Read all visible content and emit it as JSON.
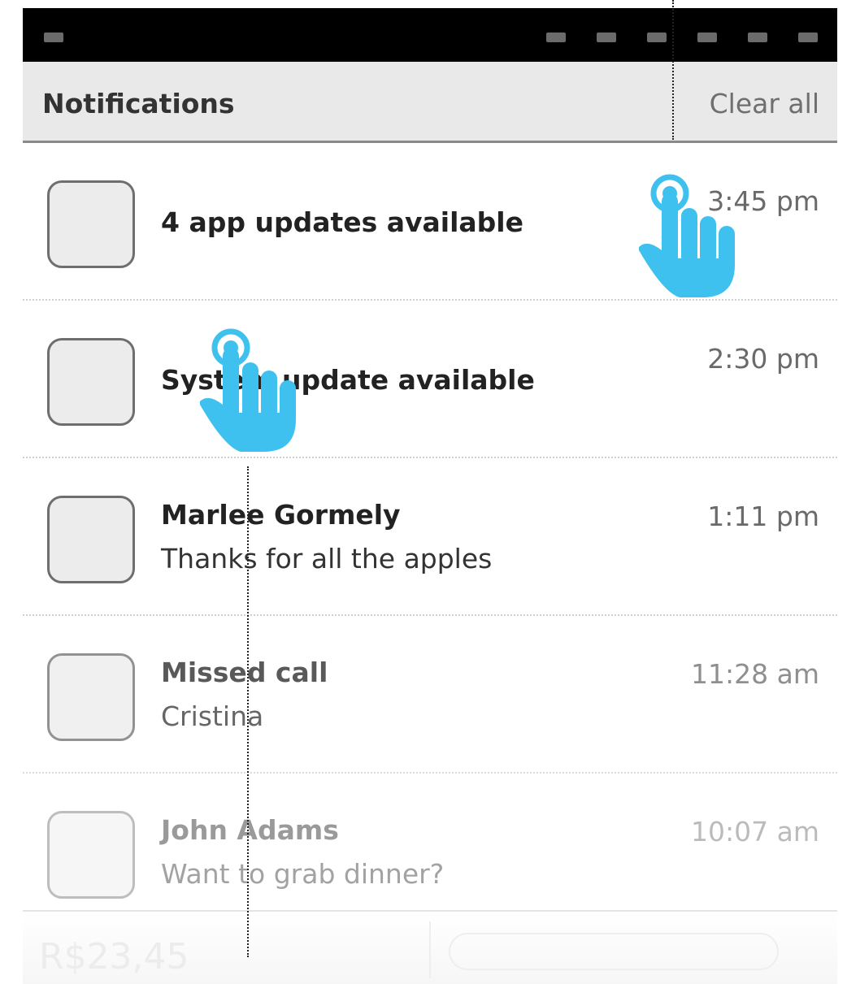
{
  "header": {
    "title": "Notifications",
    "clear_label": "Clear all"
  },
  "notifications": [
    {
      "title": "4 app updates available",
      "time": "3:45 pm"
    },
    {
      "title": "System update available",
      "time": "2:30 pm"
    },
    {
      "title": "Marlee Gormely",
      "message": "Thanks for all the apples",
      "time": "1:11 pm"
    },
    {
      "title": "Missed call",
      "message": "Cristina",
      "time": "11:28 am"
    },
    {
      "title": "John Adams",
      "message": "Want to grab dinner?",
      "time": "10:07 am"
    }
  ],
  "bottom_bar": {
    "price": "R$23,45"
  },
  "colors": {
    "accent": "#3ec1ee",
    "header_bg": "#e9e9e9",
    "status_bar": "#000000"
  },
  "annotations": {
    "tap_icon": "hand-tap-icon"
  }
}
